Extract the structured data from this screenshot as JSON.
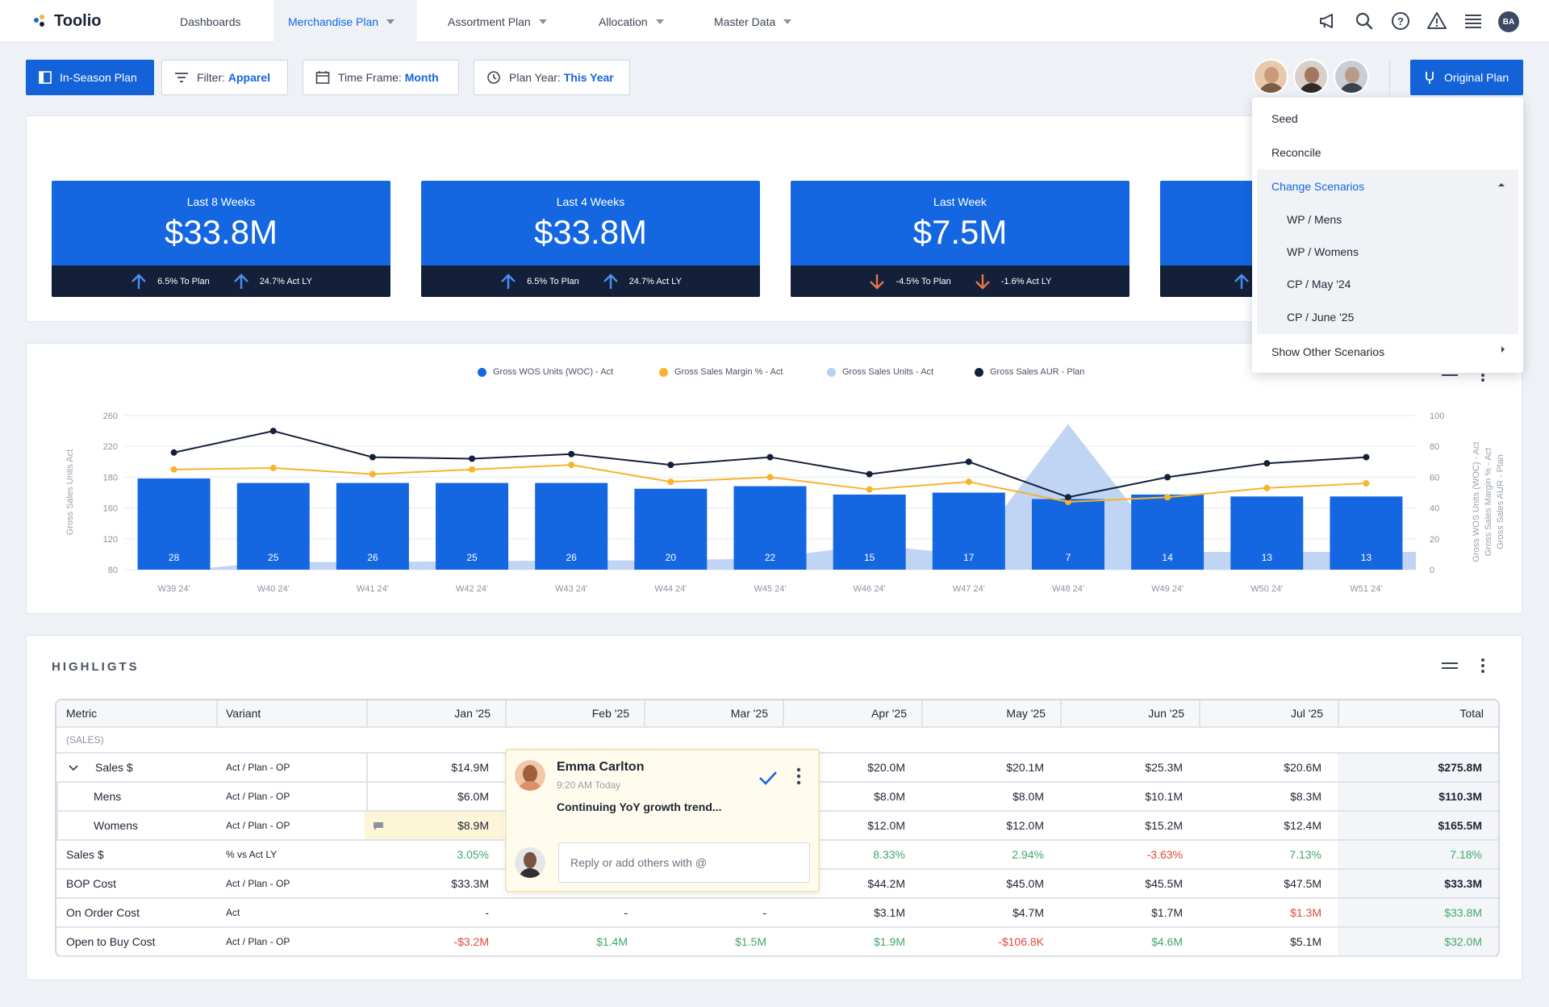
{
  "nav": {
    "brand": "Toolio",
    "tabs": [
      {
        "label": "Dashboards"
      },
      {
        "label": "Merchandise Plan"
      },
      {
        "label": "Assortment Plan"
      },
      {
        "label": "Allocation"
      },
      {
        "label": "Master Data"
      }
    ],
    "icons": [
      "megaphone-icon",
      "search-icon",
      "help-icon",
      "warning-icon",
      "menu-icon"
    ],
    "user_initials": "BA"
  },
  "toolbar": {
    "in_season_label": "In-Season Plan",
    "filter_label": "Filter:",
    "filter_value": "Apparel",
    "timeframe_label": "Time Frame:",
    "timeframe_value": "Month",
    "planyear_label": "Plan Year:",
    "planyear_value": "This Year",
    "original_plan_label": "Original Plan"
  },
  "kpis": [
    {
      "label": "Last 8 Weeks",
      "value": "$33.8M",
      "to_plan": "6.5% To Plan",
      "act_ly": "24.7% Act LY",
      "trend": "up"
    },
    {
      "label": "Last 4 Weeks",
      "value": "$33.8M",
      "to_plan": "6.5% To Plan",
      "act_ly": "24.7% Act LY",
      "trend": "up"
    },
    {
      "label": "Last Week",
      "value": "$7.5M",
      "to_plan": "-4.5% To Plan",
      "act_ly": "-1.6% Act LY",
      "trend": "down"
    }
  ],
  "dropdown": {
    "items": [
      "Seed",
      "Reconcile"
    ],
    "group_label": "Change Scenarios",
    "scenarios": [
      "WP / Mens",
      "WP / Womens",
      "CP / May '24",
      "CP / June '25"
    ],
    "other": "Show Other Scenarios"
  },
  "chart_data": {
    "type": "bar",
    "categories": [
      "W39 24'",
      "W40 24'",
      "W41 24'",
      "W42 24'",
      "W43 24'",
      "W44 24'",
      "W45 24'",
      "W46 24'",
      "W47 24'",
      "W48 24'",
      "W49 24'",
      "W50 24'",
      "W51 24'"
    ],
    "series": [
      {
        "name": "Gross WOS Units (WOC) - Act",
        "kind": "bar",
        "axis": "left",
        "color": "#1467e0",
        "values": [
          28,
          25,
          26,
          25,
          26,
          20,
          22,
          15,
          17,
          7,
          14,
          13,
          13
        ],
        "heights": [
          142,
          135,
          135,
          135,
          135,
          126,
          130,
          117,
          120,
          110,
          117,
          114,
          114
        ]
      },
      {
        "name": "Gross Sales Margin % - Act",
        "kind": "line",
        "axis": "right",
        "color": "#f7b42c",
        "values": [
          65,
          66,
          62,
          65,
          68,
          57,
          60,
          52,
          57,
          44,
          47,
          53,
          56
        ]
      },
      {
        "name": "Gross Sales Units - Act",
        "kind": "area",
        "axis": "left",
        "color": "#b9cff3",
        "values": [
          80,
          90,
          90,
          91,
          92,
          92,
          95,
          112,
          100,
          249,
          103,
          103,
          103
        ]
      },
      {
        "name": "Gross Sales AUR - Plan",
        "kind": "line",
        "axis": "right",
        "color": "#14203a",
        "values": [
          76,
          90,
          73,
          72,
          75,
          68,
          73,
          62,
          70,
          47,
          60,
          69,
          73
        ]
      }
    ],
    "left_axis": {
      "label": "Gross Sales Units Act",
      "ticks": [
        80,
        120,
        160,
        180,
        220,
        260
      ]
    },
    "right_axis": {
      "labels": [
        "Gross WOS Units (WOC) - Act",
        "Gross Sales Margin % - Act",
        "Gross Sales AUR - Plan"
      ],
      "ticks": [
        0,
        20,
        40,
        60,
        80,
        100
      ]
    }
  },
  "highlights": {
    "title": "HIGHLIGTS",
    "columns": [
      "Metric",
      "Variant",
      "Jan '25",
      "Feb '25",
      "Mar '25",
      "Apr '25",
      "May '25",
      "Jun '25",
      "Jul '25",
      "Total"
    ],
    "group": "(SALES)",
    "rows": [
      {
        "metric": "Sales $",
        "variant": "Act / Plan - OP",
        "values": [
          "$14.9M",
          "",
          "",
          "$20.0M",
          "$20.1M",
          "$25.3M",
          "$20.6M",
          "$275.8M"
        ],
        "expandable": true
      },
      {
        "metric": "Mens",
        "variant": "Act / Plan - OP",
        "values": [
          "$6.0M",
          "",
          "",
          "$8.0M",
          "$8.0M",
          "$10.1M",
          "$8.3M",
          "$110.3M"
        ]
      },
      {
        "metric": "Womens",
        "variant": "Act / Plan - OP",
        "values": [
          "$8.9M",
          "",
          "",
          "$12.0M",
          "$12.0M",
          "$15.2M",
          "$12.4M",
          "$165.5M"
        ]
      },
      {
        "metric": "Sales $",
        "variant": "% vs Act LY",
        "values": [
          "3.05%",
          "",
          "",
          "8.33%",
          "2.94%",
          "-3.63%",
          "7.13%",
          "7.18%"
        ]
      },
      {
        "metric": "BOP Cost",
        "variant": "Act / Plan - OP",
        "values": [
          "$33.3M",
          "",
          "",
          "$44.2M",
          "$45.0M",
          "$45.5M",
          "$47.5M",
          "$33.3M"
        ]
      },
      {
        "metric": "On Order Cost",
        "variant": "Act",
        "values": [
          "-",
          "-",
          "-",
          "$3.1M",
          "$4.7M",
          "$1.7M",
          "$1.3M",
          "$33.8M"
        ]
      },
      {
        "metric": "Open to Buy Cost",
        "variant": "Act / Plan - OP",
        "values": [
          "-$3.2M",
          "$1.4M",
          "$1.5M",
          "$1.9M",
          "-$106.8K",
          "$4.6M",
          "$5.1M",
          "$32.0M"
        ]
      }
    ]
  },
  "comment": {
    "author": "Emma Carlton",
    "time": "9:20 AM Today",
    "text": "Continuing YoY growth trend...",
    "reply_placeholder": "Reply or add others with @"
  }
}
